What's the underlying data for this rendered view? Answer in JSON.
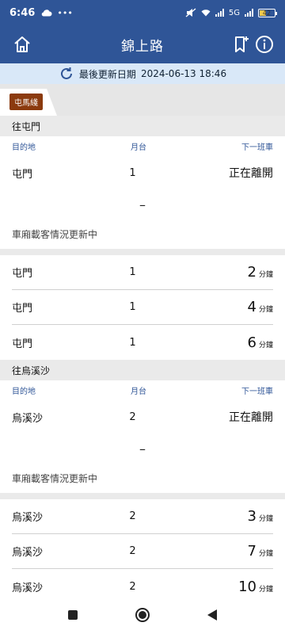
{
  "status_bar": {
    "time": "6:46",
    "icons": [
      "cloud-icon",
      "more-icon",
      "mute-icon",
      "wifi-icon",
      "signal-icon",
      "5g-icon",
      "battery-icon"
    ],
    "battery_level": "42",
    "network_label": "5G"
  },
  "header": {
    "title": "錦上路",
    "icons": [
      "home-icon",
      "bookmark-add-icon",
      "info-icon"
    ]
  },
  "update": {
    "label": "最後更新日期",
    "datetime": "2024-06-13 18:46"
  },
  "line": {
    "name": "屯馬綫",
    "color": "#8b3a0e"
  },
  "columns": {
    "destination": "目的地",
    "platform": "月台",
    "next_train": "下一班車"
  },
  "unit": "分鐘",
  "car_status_text": "車廂載客情況更新中",
  "dash": "–",
  "sections": [
    {
      "title": "往屯門",
      "first": {
        "destination": "屯門",
        "platform": "1",
        "status": "正在離開"
      },
      "rows": [
        {
          "destination": "屯門",
          "platform": "1",
          "minutes": "2"
        },
        {
          "destination": "屯門",
          "platform": "1",
          "minutes": "4"
        },
        {
          "destination": "屯門",
          "platform": "1",
          "minutes": "6"
        }
      ]
    },
    {
      "title": "往烏溪沙",
      "first": {
        "destination": "烏溪沙",
        "platform": "2",
        "status": "正在離開"
      },
      "rows": [
        {
          "destination": "烏溪沙",
          "platform": "2",
          "minutes": "3"
        },
        {
          "destination": "烏溪沙",
          "platform": "2",
          "minutes": "7"
        },
        {
          "destination": "烏溪沙",
          "platform": "2",
          "minutes": "10"
        }
      ]
    }
  ],
  "colors": {
    "primary": "#2f5597",
    "banner": "#d9e8f8",
    "section": "#eaeaea"
  }
}
